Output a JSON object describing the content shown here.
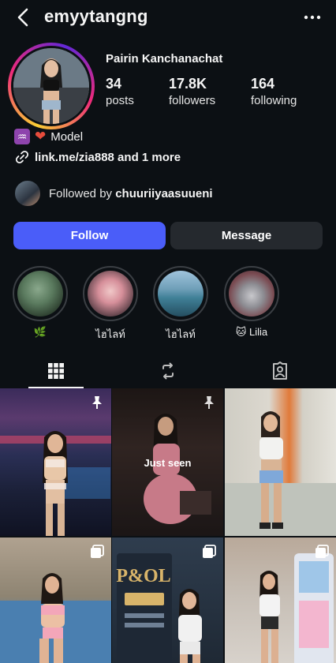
{
  "header": {
    "username": "emyytangng"
  },
  "profile": {
    "full_name": "Pairin Kanchanachat",
    "stats": [
      {
        "value": "34",
        "label": "posts"
      },
      {
        "value": "17.8K",
        "label": "followers"
      },
      {
        "value": "164",
        "label": "following"
      }
    ],
    "bio_emoji": "♒",
    "bio": "Model",
    "link": "link.me/zia888 and 1 more",
    "followed_by_prefix": "Followed by ",
    "followed_by_user": "chuuriiyaasuueni"
  },
  "buttons": {
    "follow": "Follow",
    "message": "Message"
  },
  "highlights": [
    {
      "label": "🌿"
    },
    {
      "label": "ไฮไลท์"
    },
    {
      "label": "ไฮไลท์"
    },
    {
      "label": "🐱 Lilia"
    }
  ],
  "tabs": [
    "grid-icon",
    "reels-icon",
    "tagged-icon"
  ],
  "grid": {
    "just_seen": "Just seen"
  },
  "colors": {
    "background": "#0c1014",
    "follow_button": "#4a5df9",
    "message_button": "#25292e"
  }
}
